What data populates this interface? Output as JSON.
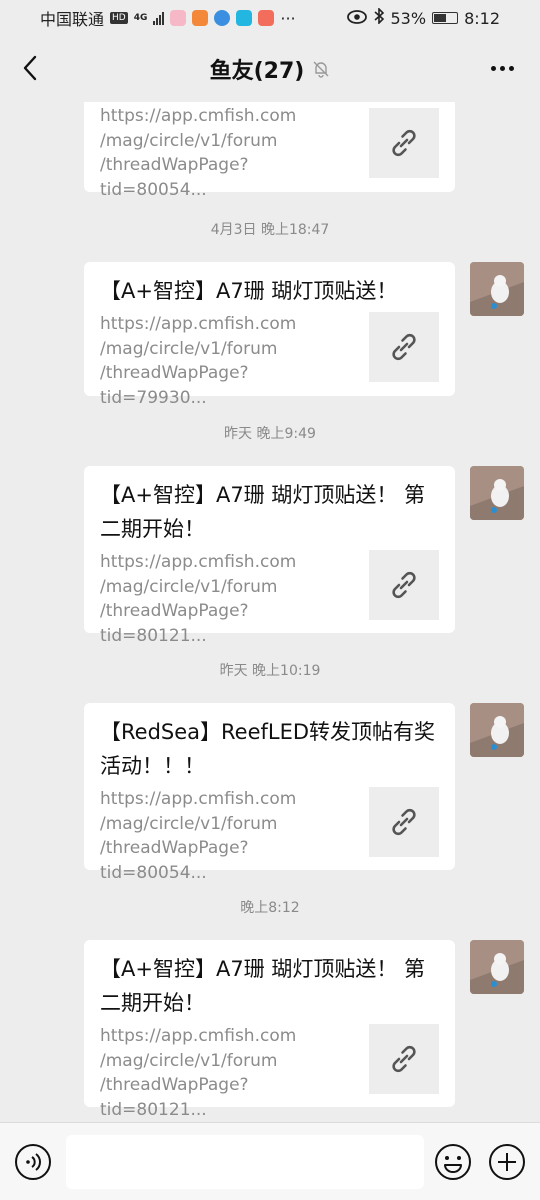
{
  "status_bar": {
    "carrier": "中国联通",
    "network_badge": "HD",
    "network_type": "4G",
    "battery_percent": "53%",
    "time": "8:12",
    "battery_level": 0.53
  },
  "header": {
    "title": "鱼友(27)",
    "mute_icon": "bell-off-icon"
  },
  "messages": [
    {
      "timestamp": "",
      "title": "",
      "url_lines": "https://app.cmfish.com\n/mag/circle/v1/forum\n/threadWapPage?tid=80054..."
    },
    {
      "timestamp": "4月3日 晚上18:47",
      "title": "【A+智控】A7珊 瑚灯顶贴送！",
      "url_lines": "https://app.cmfish.com\n/mag/circle/v1/forum\n/threadWapPage?tid=79930..."
    },
    {
      "timestamp": "昨天 晚上9:49",
      "title": "【A+智控】A7珊 瑚灯顶贴送！ 第二期开始！",
      "url_lines": "https://app.cmfish.com\n/mag/circle/v1/forum\n/threadWapPage?tid=80121..."
    },
    {
      "timestamp": "昨天 晚上10:19",
      "title": "【RedSea】ReefLED转发顶帖有奖活动！！！",
      "url_lines": "https://app.cmfish.com\n/mag/circle/v1/forum\n/threadWapPage?tid=80054..."
    },
    {
      "timestamp": "晚上8:12",
      "title": "【A+智控】A7珊 瑚灯顶贴送！ 第二期开始！",
      "url_lines": "https://app.cmfish.com\n/mag/circle/v1/forum\n/threadWapPage?tid=80121..."
    }
  ],
  "input_bar": {
    "placeholder": ""
  },
  "colors": {
    "background": "#ededed",
    "bubble": "#ffffff",
    "timestamp_text": "#8a8a8a",
    "url_text": "#8b8b8b"
  }
}
